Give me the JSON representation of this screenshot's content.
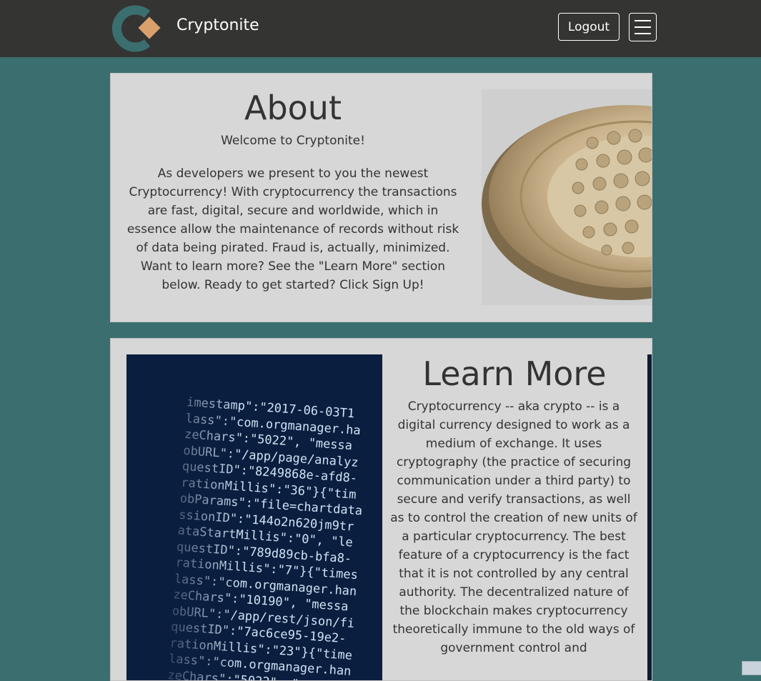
{
  "nav": {
    "brand": "Cryptonite",
    "logout_label": "Logout",
    "menu_icon": "hamburger-menu-icon",
    "logo_icon": "cryptonite-logo-icon"
  },
  "about": {
    "title": "About",
    "welcome": "Welcome to Cryptonite!",
    "body": "As developers we present to you the newest Cryptocurrency! With cryptocurrency the transactions are fast, digital, secure and worldwide, which in essence allow the maintenance of records without risk of data being pirated. Fraud is, actually, minimized. Want to learn more? See the \"Learn More\" section below. Ready to get started? Click Sign Up!",
    "image": "crypto-coin-image"
  },
  "learn_more": {
    "title": "Learn More",
    "body": "Cryptocurrency -- aka crypto -- is a digital currency designed to work as a medium of exchange. It uses cryptography (the practice of securing communication under a third party) to secure and verify transactions, as well as to control the creation of new units of a particular cryptocurrency. The best feature of a cryptocurrency is the fact that it is not controlled by any central authority. The decentralized nature of the blockchain makes cryptocurrency theoretically immune to the old ways of government control and",
    "image": "code-screen-image"
  },
  "colors": {
    "navbar": "#343433",
    "page_bg": "#3b6e6f",
    "card_bg": "#d7d7d7",
    "logo_teal": "#3b6e6f",
    "logo_gold": "#d9a06c"
  }
}
